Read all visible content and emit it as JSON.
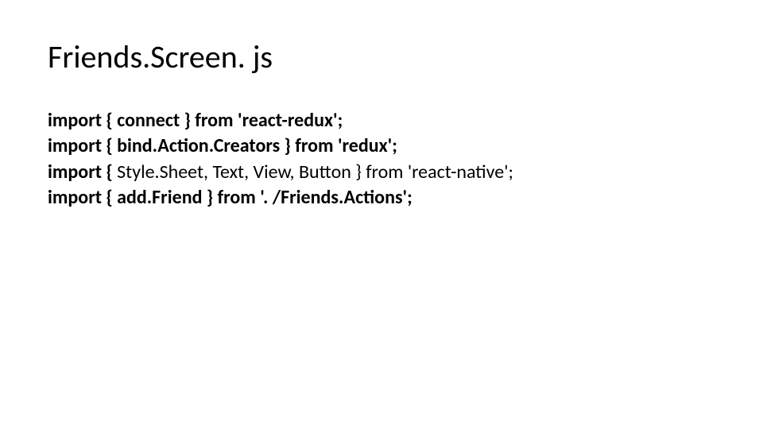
{
  "title": "Friends.Screen. js",
  "lines": {
    "l1": {
      "p1": "import { connect } from 'react-redux';"
    },
    "l2": {
      "p1": "import { bind.Action.Creators } from 'redux';"
    },
    "l3": {
      "p1": "import { ",
      "p2": "Style.Sheet, Text, View, Button } from 'react-native';"
    },
    "l4": {
      "p1": "import { add.Friend } from '. /Friends.Actions';"
    }
  }
}
